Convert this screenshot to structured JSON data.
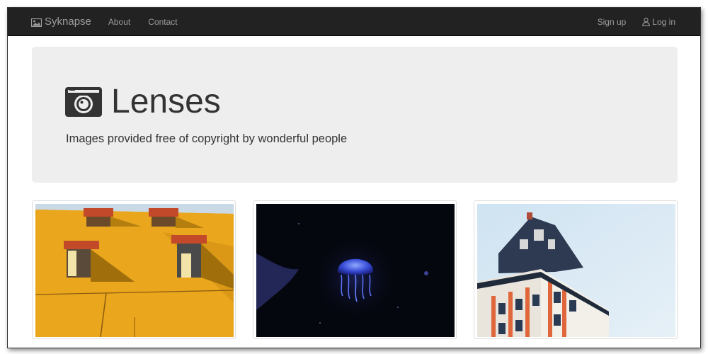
{
  "navbar": {
    "brand": "Syknapse",
    "brand_icon": "image-icon",
    "links": [
      "About",
      "Contact"
    ],
    "signup": "Sign up",
    "login": "Log in",
    "login_icon": "user-icon"
  },
  "jumbotron": {
    "title": "Lenses",
    "title_icon": "camera-icon",
    "subtitle": "Images provided free of copyright by wonderful people"
  },
  "gallery": [
    {
      "subject": "yellow building wall with windows"
    },
    {
      "subject": "blue jellyfish on dark background"
    },
    {
      "subject": "orange and white corner building against blue sky"
    }
  ],
  "colors": {
    "navbar_bg": "#222222",
    "nav_text": "#9d9d9d",
    "jumbotron_bg": "#eeeeee"
  }
}
